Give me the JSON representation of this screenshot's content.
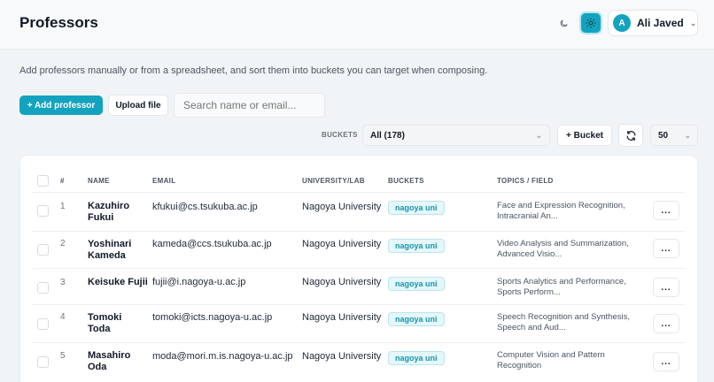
{
  "header": {
    "title": "Professors"
  },
  "user": {
    "initial": "A",
    "name": "Ali Javed"
  },
  "description": "Add professors manually or from a spreadsheet, and sort them into buckets you can target when composing.",
  "toolbar": {
    "add_label": "+ Add professor",
    "upload_label": "Upload file",
    "search_placeholder": "Search name or email..."
  },
  "filters": {
    "buckets_label": "BUCKETS",
    "bucket_value": "All (178)",
    "add_bucket_label": "+ Bucket",
    "page_size": "50"
  },
  "table": {
    "headers": {
      "num": "#",
      "name": "NAME",
      "email": "EMAIL",
      "university": "UNIVERSITY/LAB",
      "buckets": "BUCKETS",
      "topics": "TOPICS / FIELD"
    },
    "rows": [
      {
        "num": "1",
        "name_line1": "Kazuhiro",
        "name_line2": "Fukui",
        "email": "kfukui@cs.tsukuba.ac.jp",
        "university": "Nagoya University",
        "bucket": "nagoya uni",
        "topic_line1": "Face and Expression Recognition,",
        "topic_line2": "Intracranial An...",
        "more": "..."
      },
      {
        "num": "2",
        "name_line1": "Yoshinari",
        "name_line2": "Kameda",
        "email": "kameda@ccs.tsukuba.ac.jp",
        "university": "Nagoya University",
        "bucket": "nagoya uni",
        "topic_line1": "Video Analysis and Summarization,",
        "topic_line2": "Advanced Visio...",
        "more": "..."
      },
      {
        "num": "3",
        "name_line1": "Keisuke Fujii",
        "name_line2": "",
        "email": "fujii@i.nagoya-u.ac.jp",
        "university": "Nagoya University",
        "bucket": "nagoya uni",
        "topic_line1": "Sports Analytics and Performance,",
        "topic_line2": "Sports Perform...",
        "more": "..."
      },
      {
        "num": "4",
        "name_line1": "Tomoki",
        "name_line2": "Toda",
        "email": "tomoki@icts.nagoya-u.ac.jp",
        "university": "Nagoya University",
        "bucket": "nagoya uni",
        "topic_line1": "Speech Recognition and Synthesis,",
        "topic_line2": "Speech and Aud...",
        "more": "..."
      },
      {
        "num": "5",
        "name_line1": "Masahiro",
        "name_line2": "Oda",
        "email": "moda@mori.m.is.nagoya-u.ac.jp",
        "university": "Nagoya University",
        "bucket": "nagoya uni",
        "topic_line1": "Computer Vision and Pattern",
        "topic_line2": "Recognition",
        "more": "..."
      }
    ]
  },
  "icons": {
    "moon": "moon-icon",
    "sun": "sun-icon",
    "caret": "chevron-down-icon",
    "refresh": "refresh-icon"
  },
  "colors": {
    "accent": "#14a3be",
    "badge_bg": "#e6f7fa",
    "badge_text": "#1596ae"
  }
}
